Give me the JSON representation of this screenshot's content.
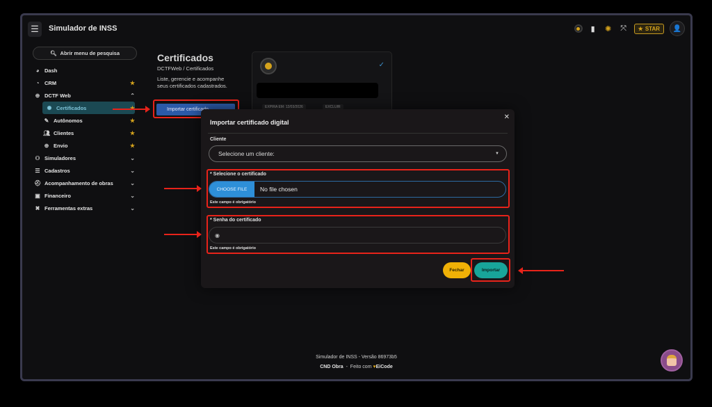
{
  "app": {
    "title": "Simulador de INSS",
    "star_label": "STAR"
  },
  "sidebar": {
    "search_label": "Abrir menu de pesquisa",
    "items": [
      {
        "label": "Dash"
      },
      {
        "label": "CRM"
      },
      {
        "label": "DCTF Web"
      },
      {
        "label": "Certificados"
      },
      {
        "label": "Autônomos"
      },
      {
        "label": "Clientes"
      },
      {
        "label": "Envio"
      },
      {
        "label": "Simuladores"
      },
      {
        "label": "Cadastros"
      },
      {
        "label": "Acompanhamento de obras"
      },
      {
        "label": "Financeiro"
      },
      {
        "label": "Ferramentas extras"
      }
    ]
  },
  "page": {
    "title": "Certificados",
    "breadcrumb": "DCTFWeb / Certificados",
    "description": "Liste, gerencie e acompanhe seus certificados cadastrados.",
    "import_button": "Importar certificado"
  },
  "cert_card": {
    "expira": "EXPIRA EM: 12/03/2026",
    "excluir": "EXCLUIR"
  },
  "modal": {
    "title": "Importar certificado digital",
    "client_label": "Cliente",
    "client_placeholder": "Selecione um cliente:",
    "cert_label": "* Selecione o certificado",
    "choose_file": "CHOOSE FILE",
    "no_file": "No file chosen",
    "required_1": "Este campo é obrigatório",
    "password_label": "* Senha do certificado",
    "required_2": "Este campo é obrigatório",
    "close_button": "Fechar",
    "import_button": "Importar"
  },
  "footer": {
    "version": "Simulador de INSS - Versão 86973b5",
    "cnd": "CND Obra",
    "sep": "-",
    "made_with": "Feito com",
    "brand": "EiCode"
  }
}
